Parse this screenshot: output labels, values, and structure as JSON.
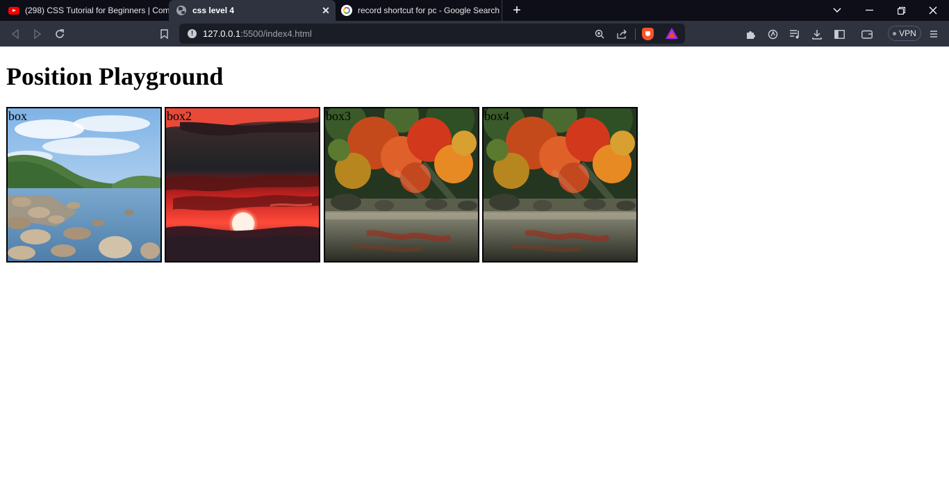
{
  "tabs": [
    {
      "title": "(298) CSS Tutorial for Beginners | Com",
      "favicon": "youtube-icon"
    },
    {
      "title": "css level 4",
      "favicon": "globe-icon"
    },
    {
      "title": "record shortcut for pc - Google Search",
      "favicon": "google-icon"
    }
  ],
  "url": {
    "host": "127.0.0.1",
    "path": ":5500/index4.html"
  },
  "vpn_label": "VPN",
  "page": {
    "title": "Position Playground",
    "boxes": [
      {
        "label": "box",
        "image": "lake-landscape"
      },
      {
        "label": "box2",
        "image": "red-sunset"
      },
      {
        "label": "box3",
        "image": "autumn-garden"
      },
      {
        "label": "box4",
        "image": "autumn-garden"
      }
    ]
  },
  "colors": {
    "tabstrip": "#0d0e18",
    "toolbar": "#2f3340",
    "urlbar": "#1b1d26",
    "page": "#ffffff"
  }
}
